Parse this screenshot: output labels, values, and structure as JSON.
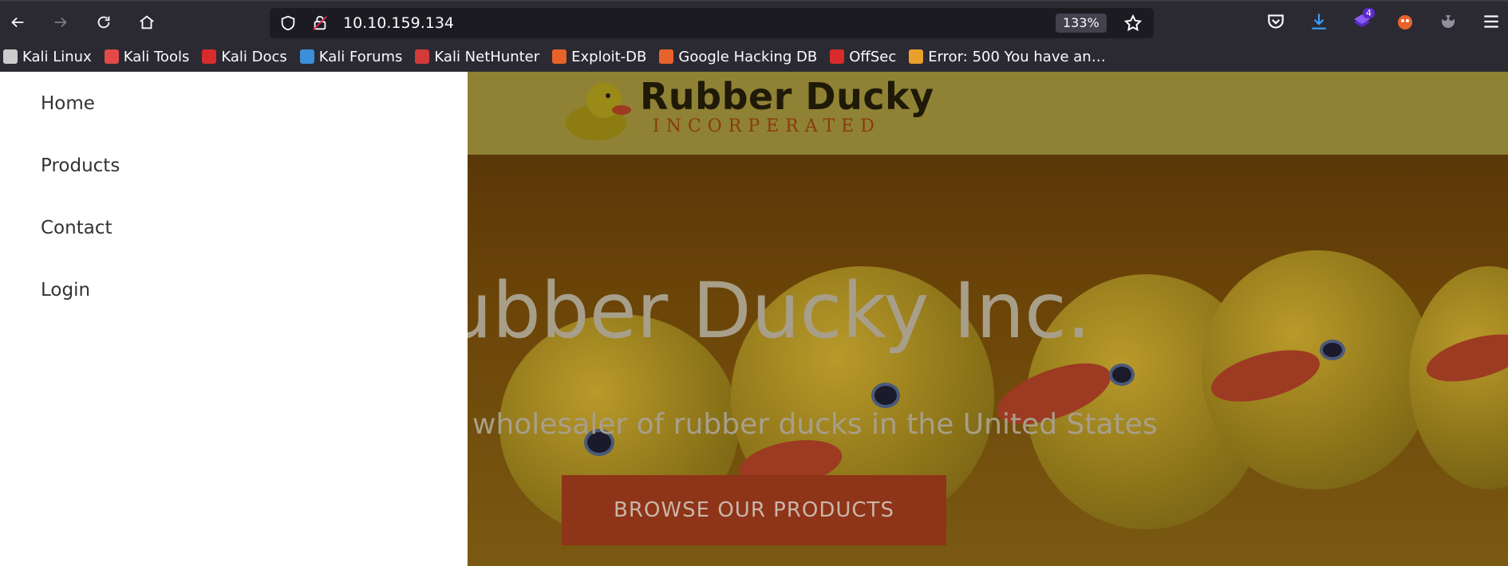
{
  "browser": {
    "url": "10.10.159.134",
    "zoom": "133%",
    "extension_badge": "4"
  },
  "bookmarks": [
    {
      "label": "Kali Linux",
      "icon": "kali-dragon-icon",
      "color": "#cccccc"
    },
    {
      "label": "Kali Tools",
      "icon": "kali-tools-icon",
      "color": "#e24a4a"
    },
    {
      "label": "Kali Docs",
      "icon": "kali-docs-icon",
      "color": "#d92b2b"
    },
    {
      "label": "Kali Forums",
      "icon": "kali-forums-icon",
      "color": "#3b8ed8"
    },
    {
      "label": "Kali NetHunter",
      "icon": "kali-nethunter-icon",
      "color": "#d33b3b"
    },
    {
      "label": "Exploit-DB",
      "icon": "exploit-db-icon",
      "color": "#e8632b"
    },
    {
      "label": "Google Hacking DB",
      "icon": "ghdb-icon",
      "color": "#e8632b"
    },
    {
      "label": "OffSec",
      "icon": "offsec-icon",
      "color": "#d92b2b"
    },
    {
      "label": "Error: 500 You have an…",
      "icon": "joomla-icon",
      "color": "#e8a02b"
    }
  ],
  "sidebar": {
    "items": [
      {
        "label": "Home"
      },
      {
        "label": "Products"
      },
      {
        "label": "Contact"
      },
      {
        "label": "Login"
      }
    ]
  },
  "site": {
    "logo_title": "Rubber Ducky",
    "logo_subtitle": "INCORPERATED"
  },
  "hero": {
    "title": "ubber Ducky Inc.",
    "subtitle": "wholesaler of rubber ducks in the United States",
    "cta_label": "BROWSE OUR PRODUCTS"
  }
}
